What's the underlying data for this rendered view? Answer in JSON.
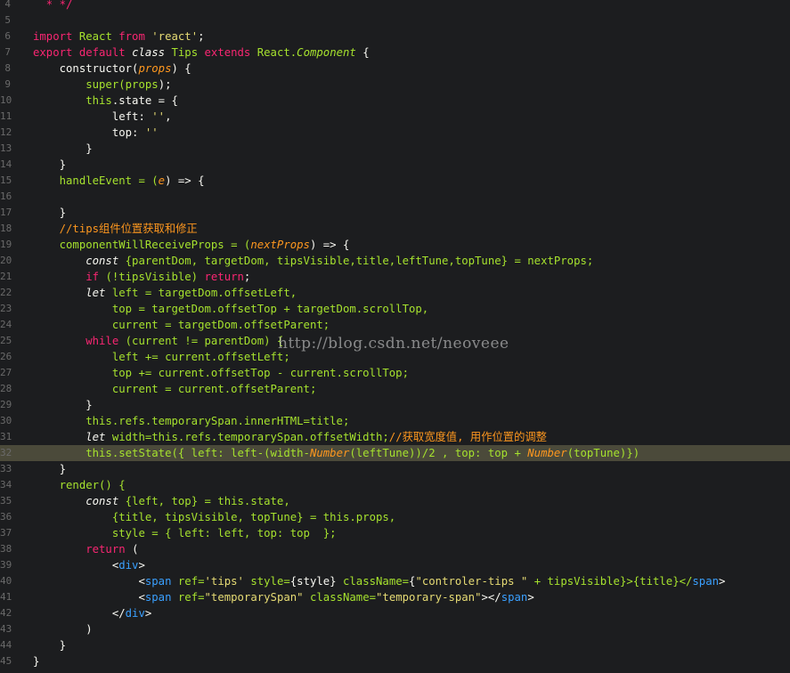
{
  "editor": {
    "highlighted_line_index": 28,
    "watermark": "http://blog.csdn.net/neoveee",
    "lines": [
      {
        "n": "4",
        "tokens": [
          {
            "t": "  * */",
            "c": "kw"
          }
        ]
      },
      {
        "n": "5",
        "tokens": []
      },
      {
        "n": "6",
        "tokens": [
          {
            "t": "import ",
            "c": "kw"
          },
          {
            "t": "React ",
            "c": "fn"
          },
          {
            "t": "from ",
            "c": "kw"
          },
          {
            "t": "'react'",
            "c": "str"
          },
          {
            "t": ";",
            "c": "plain"
          }
        ]
      },
      {
        "n": "7",
        "tokens": [
          {
            "t": "export default ",
            "c": "kw"
          },
          {
            "t": "class ",
            "c": "it"
          },
          {
            "t": "Tips ",
            "c": "fn"
          },
          {
            "t": "extends ",
            "c": "kw"
          },
          {
            "t": "React.",
            "c": "fn"
          },
          {
            "t": "Component",
            "c": "cls"
          },
          {
            "t": " {",
            "c": "plain"
          }
        ]
      },
      {
        "n": "8",
        "tokens": [
          {
            "t": "    constructor(",
            "c": "plain"
          },
          {
            "t": "props",
            "c": "param"
          },
          {
            "t": ") {",
            "c": "plain"
          }
        ]
      },
      {
        "n": "9",
        "tokens": [
          {
            "t": "        super(",
            "c": "fn"
          },
          {
            "t": "props",
            "c": "fn"
          },
          {
            "t": ");",
            "c": "plain"
          }
        ]
      },
      {
        "n": "10",
        "tokens": [
          {
            "t": "        this",
            "c": "fn"
          },
          {
            "t": ".state = {",
            "c": "plain"
          }
        ]
      },
      {
        "n": "11",
        "tokens": [
          {
            "t": "            left: ",
            "c": "plain"
          },
          {
            "t": "''",
            "c": "str"
          },
          {
            "t": ",",
            "c": "plain"
          }
        ]
      },
      {
        "n": "12",
        "tokens": [
          {
            "t": "            top: ",
            "c": "plain"
          },
          {
            "t": "''",
            "c": "str"
          }
        ]
      },
      {
        "n": "13",
        "tokens": [
          {
            "t": "        }",
            "c": "plain"
          }
        ]
      },
      {
        "n": "14",
        "tokens": [
          {
            "t": "    }",
            "c": "plain"
          }
        ]
      },
      {
        "n": "15",
        "tokens": [
          {
            "t": "    handleEvent = (",
            "c": "fn"
          },
          {
            "t": "e",
            "c": "param"
          },
          {
            "t": ") => {",
            "c": "plain"
          }
        ]
      },
      {
        "n": "16",
        "tokens": []
      },
      {
        "n": "17",
        "tokens": [
          {
            "t": "    }",
            "c": "plain"
          }
        ]
      },
      {
        "n": "18",
        "tokens": [
          {
            "t": "    //tips组件位置获取和修正",
            "c": "cm"
          }
        ]
      },
      {
        "n": "19",
        "tokens": [
          {
            "t": "    componentWillReceiveProps = (",
            "c": "fn"
          },
          {
            "t": "nextProps",
            "c": "param"
          },
          {
            "t": ") => {",
            "c": "plain"
          }
        ]
      },
      {
        "n": "20",
        "tokens": [
          {
            "t": "        const ",
            "c": "it"
          },
          {
            "t": "{parentDom, targetDom, tipsVisible,title,leftTune,topTune} = nextProps;",
            "c": "fn"
          }
        ]
      },
      {
        "n": "21",
        "tokens": [
          {
            "t": "        if ",
            "c": "kw"
          },
          {
            "t": "(!tipsVisible) ",
            "c": "fn"
          },
          {
            "t": "return",
            "c": "kw"
          },
          {
            "t": ";",
            "c": "plain"
          }
        ]
      },
      {
        "n": "22",
        "tokens": [
          {
            "t": "        let ",
            "c": "it"
          },
          {
            "t": "left = targetDom.offsetLeft,",
            "c": "fn"
          }
        ]
      },
      {
        "n": "23",
        "tokens": [
          {
            "t": "            top = targetDom.offsetTop + targetDom.scrollTop,",
            "c": "fn"
          }
        ]
      },
      {
        "n": "24",
        "tokens": [
          {
            "t": "            current = targetDom.offsetParent;",
            "c": "fn"
          }
        ]
      },
      {
        "n": "25",
        "tokens": [
          {
            "t": "        while ",
            "c": "kw"
          },
          {
            "t": "(current != parentDom) {",
            "c": "fn"
          }
        ]
      },
      {
        "n": "26",
        "tokens": [
          {
            "t": "            left += current.offsetLeft;",
            "c": "fn"
          }
        ]
      },
      {
        "n": "27",
        "tokens": [
          {
            "t": "            top += current.offsetTop - current.scrollTop;",
            "c": "fn"
          }
        ]
      },
      {
        "n": "28",
        "tokens": [
          {
            "t": "            current = current.offsetParent;",
            "c": "fn"
          }
        ]
      },
      {
        "n": "29",
        "tokens": [
          {
            "t": "        }",
            "c": "plain"
          }
        ]
      },
      {
        "n": "30",
        "tokens": [
          {
            "t": "        this.refs.temporarySpan.innerHTML=title;",
            "c": "fn"
          }
        ]
      },
      {
        "n": "31",
        "tokens": [
          {
            "t": "        let ",
            "c": "it"
          },
          {
            "t": "width=this.refs.temporarySpan.offsetWidth;",
            "c": "fn"
          },
          {
            "t": "//获取宽度值, 用作位置的调整",
            "c": "cm"
          }
        ]
      },
      {
        "n": "32",
        "tokens": [
          {
            "t": "        this.setState({ left: left-(width-",
            "c": "fn"
          },
          {
            "t": "Number",
            "c": "param"
          },
          {
            "t": "(leftTune))/2 , top: top + ",
            "c": "fn"
          },
          {
            "t": "Number",
            "c": "param"
          },
          {
            "t": "(topTune)})",
            "c": "fn"
          }
        ]
      },
      {
        "n": "33",
        "tokens": [
          {
            "t": "    }",
            "c": "plain"
          }
        ]
      },
      {
        "n": "34",
        "tokens": [
          {
            "t": "    render() {",
            "c": "fn"
          }
        ]
      },
      {
        "n": "35",
        "tokens": [
          {
            "t": "        const ",
            "c": "it"
          },
          {
            "t": "{left, top} = this.state,",
            "c": "fn"
          }
        ]
      },
      {
        "n": "36",
        "tokens": [
          {
            "t": "            {title, tipsVisible, topTune} = this.props,",
            "c": "fn"
          }
        ]
      },
      {
        "n": "37",
        "tokens": [
          {
            "t": "            style = { left: left, top: top  };",
            "c": "fn"
          }
        ]
      },
      {
        "n": "38",
        "tokens": [
          {
            "t": "        return ",
            "c": "kw"
          },
          {
            "t": "(",
            "c": "plain"
          }
        ]
      },
      {
        "n": "39",
        "tokens": [
          {
            "t": "            <",
            "c": "plain"
          },
          {
            "t": "div",
            "c": "tag"
          },
          {
            "t": ">",
            "c": "plain"
          }
        ]
      },
      {
        "n": "40",
        "tokens": [
          {
            "t": "                <",
            "c": "plain"
          },
          {
            "t": "span ",
            "c": "tag"
          },
          {
            "t": "ref=",
            "c": "attr"
          },
          {
            "t": "'tips' ",
            "c": "str"
          },
          {
            "t": "style=",
            "c": "attr"
          },
          {
            "t": "{style} ",
            "c": "plain"
          },
          {
            "t": "className=",
            "c": "attr"
          },
          {
            "t": "{",
            "c": "plain"
          },
          {
            "t": "\"controler-tips \" ",
            "c": "str"
          },
          {
            "t": "+ tipsVisible}>{title}</",
            "c": "fn"
          },
          {
            "t": "span",
            "c": "tag"
          },
          {
            "t": ">",
            "c": "plain"
          }
        ]
      },
      {
        "n": "41",
        "tokens": [
          {
            "t": "                <",
            "c": "plain"
          },
          {
            "t": "span ",
            "c": "tag"
          },
          {
            "t": "ref=",
            "c": "attr"
          },
          {
            "t": "\"temporarySpan\" ",
            "c": "str"
          },
          {
            "t": "className=",
            "c": "attr"
          },
          {
            "t": "\"temporary-span\"",
            "c": "str"
          },
          {
            "t": "></",
            "c": "plain"
          },
          {
            "t": "span",
            "c": "tag"
          },
          {
            "t": ">",
            "c": "plain"
          }
        ]
      },
      {
        "n": "42",
        "tokens": [
          {
            "t": "            </",
            "c": "plain"
          },
          {
            "t": "div",
            "c": "tag"
          },
          {
            "t": ">",
            "c": "plain"
          }
        ]
      },
      {
        "n": "43",
        "tokens": [
          {
            "t": "        )",
            "c": "plain"
          }
        ]
      },
      {
        "n": "44",
        "tokens": [
          {
            "t": "    }",
            "c": "plain"
          }
        ]
      },
      {
        "n": "45",
        "tokens": [
          {
            "t": "}",
            "c": "plain"
          }
        ]
      }
    ]
  }
}
